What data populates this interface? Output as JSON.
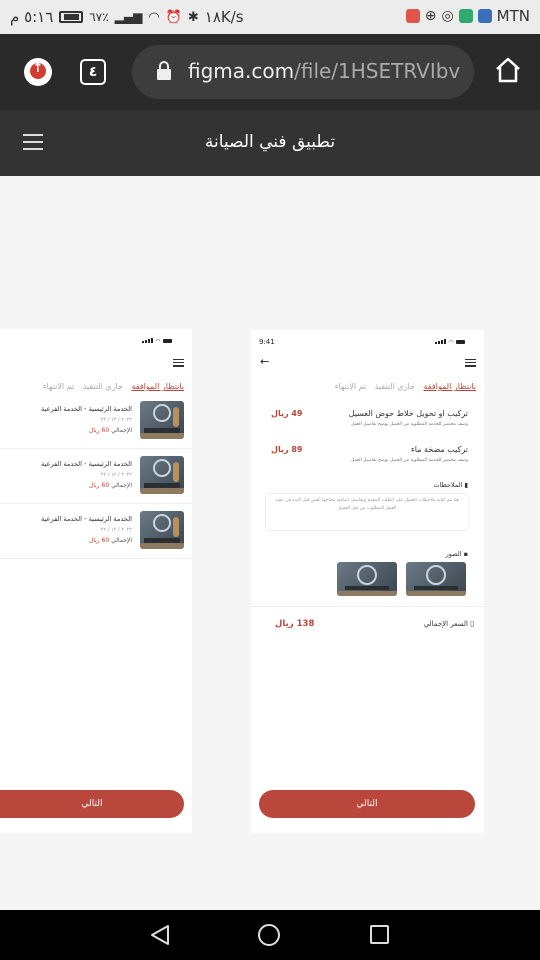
{
  "statusbar": {
    "time": "٥:١٦ م",
    "battery": "٦٧٪",
    "speed": "١٨K/s",
    "carrier": "MTN"
  },
  "browser": {
    "tab_count": "٤",
    "url_main": "figma.com",
    "url_rest": "/file/1HSETRVIbv"
  },
  "figma": {
    "title": "تطبيق فني الصيانة"
  },
  "screen_orders": {
    "tabs": [
      "بانتظار الموافقة",
      "جاري التنفيذ",
      "تم الانتهاء"
    ],
    "orders": [
      {
        "title": "الخدمة الرئيسية - الخدمة الفرعية",
        "date": "٢٠٢٢ / ١٢ / ٢٢",
        "total_label": "الإجمالي",
        "total_value": "60 ريال"
      },
      {
        "title": "الخدمة الرئيسية - الخدمة الفرعية",
        "date": "٢٠٢٢ / ١٢ / ٢٢",
        "total_label": "الإجمالي",
        "total_value": "60 ريال"
      },
      {
        "title": "الخدمة الرئيسية - الخدمة الفرعية",
        "date": "٢٠٢٢ / ١٢ / ٢٢",
        "total_label": "الإجمالي",
        "total_value": "60 ريال"
      }
    ],
    "next_button": "التالي"
  },
  "screen_details": {
    "time": "9:41",
    "tabs": [
      "بانتظار الموافقة",
      "جاري التنفيذ",
      "تم الانتهاء"
    ],
    "services": [
      {
        "name": "تركيب او تحويل خلاط حوض الغسيل",
        "desc": "وصف مختصر للخدمة المطلوبة من العميل يوضح تفاصيل العمل",
        "price": "49 ريال"
      },
      {
        "name": "تركيب مضخة ماء",
        "desc": "وصف مختصر للخدمة المطلوبة من العميل يوضح تفاصيل العمل",
        "price": "89 ريال"
      }
    ],
    "notes_title": "الملاحظات",
    "notes_text": "هنا يتم كتابة ملاحظات العميل على الطلب المقدم وتفاصيل اضافية يحتاجها الفني قبل البدء في تنفيذ العمل المطلوب من قبل العميل",
    "photos_title": "الصور",
    "total_label": "السعر الإجمالي",
    "total_value": "138 ريال",
    "next_button": "التالي"
  }
}
